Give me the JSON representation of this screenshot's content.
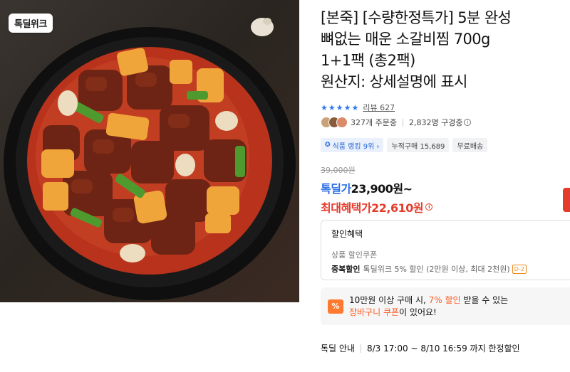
{
  "image": {
    "brand_badge": "톡딜위크"
  },
  "product": {
    "title_lines": [
      "[본죽] [수량한정특가] 5분 완성",
      "뼈없는 매운 소갈비찜 700g",
      "1+1팩 (총2팩)",
      "원산지: 상세설명에 표시"
    ],
    "rating_stars": 5,
    "review_label": "리뷰 627",
    "orders": "327개 주문중",
    "viewers": "2,832명 구경중",
    "chips": {
      "ranking": "식품 랭킹 9위 ›",
      "cumulative": "누적구매 15,689",
      "shipping": "무료배송"
    }
  },
  "pricing": {
    "original": "39,000원",
    "sale_label": "톡딜가",
    "sale_value": "23,900원~",
    "max_label": "최대혜택가",
    "max_value": "22,610원"
  },
  "discount": {
    "title": "할인혜택",
    "line1": "상품 할인쿠폰",
    "line2_strong": "중복할인",
    "line2_text": "톡딜위크 5% 할인 (2만원 이상, 최대 2천원)",
    "line2_badge": "D-2"
  },
  "coupon": {
    "icon": "%",
    "line1_a": "10만원 이상 구매 시, ",
    "line1_highlight": "7% 할인",
    "line1_b": " 받을 수 있는",
    "line2_highlight": "장바구니 쿠폰",
    "line2_b": "이 있어요!"
  },
  "notice": {
    "label": "톡딜 안내",
    "text": "8/3 17:00 ~ 8/10 16:59 까지 한정할인"
  },
  "colors": {
    "accent_blue": "#2b6fe8",
    "accent_red": "#e53b2c",
    "accent_orange": "#ff7a2f"
  }
}
